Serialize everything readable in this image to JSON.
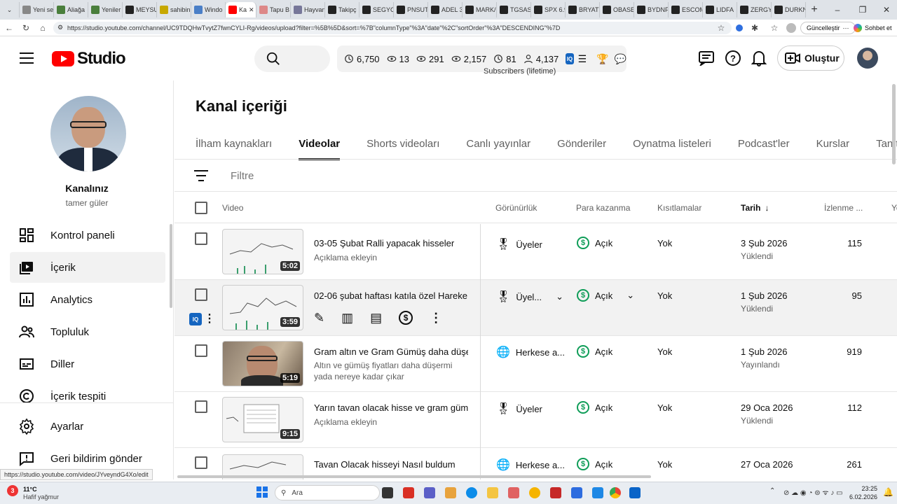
{
  "browser": {
    "tabs": [
      "Yeni se",
      "Aliağa",
      "Yeniler",
      "MEYSU",
      "sahibin",
      "Windo",
      "Ka",
      "Tapu B",
      "Hayvan",
      "Takipç",
      "SEGYO",
      "PNSUT",
      "ADEL 3",
      "MARK/",
      "TGSAS",
      "SPX 6.9",
      "BRYAT",
      "OBASE",
      "BYDNF",
      "ESCOM",
      "LIDFA",
      "ZERGY",
      "DURKN"
    ],
    "url": "https://studio.youtube.com/channel/UC9TDQHwTvytZ7fwnCYLI-Rg/videos/upload?filter=%5B%5D&sort=%7B\"columnType\"%3A\"date\"%2C\"sortOrder\"%3A\"DESCENDING\"%7D",
    "update_label": "Güncelleştir",
    "chat_label": "Sohbet et"
  },
  "header": {
    "logo_text": "Studio",
    "stats": [
      "6,750",
      "13",
      "291",
      "2,157",
      "81",
      "4,137"
    ],
    "tooltip": "Subscribers (lifetime)",
    "create_label": "Oluştur"
  },
  "sidebar": {
    "channel_title": "Kanalınız",
    "channel_name": "tamer güler",
    "items": [
      {
        "label": "Kontrol paneli",
        "icon": "dashboard-icon"
      },
      {
        "label": "İçerik",
        "icon": "content-icon"
      },
      {
        "label": "Analytics",
        "icon": "analytics-icon"
      },
      {
        "label": "Topluluk",
        "icon": "community-icon"
      },
      {
        "label": "Diller",
        "icon": "subtitles-icon"
      },
      {
        "label": "İçerik tespiti",
        "icon": "copyright-icon"
      },
      {
        "label": "Ayarlar",
        "icon": "settings-icon"
      },
      {
        "label": "Geri bildirim gönder",
        "icon": "feedback-icon"
      }
    ]
  },
  "main": {
    "title": "Kanal içeriği",
    "tabs": [
      "İlham kaynakları",
      "Videolar",
      "Shorts videoları",
      "Canlı yayınlar",
      "Gönderiler",
      "Oynatma listeleri",
      "Podcast'ler",
      "Kurslar",
      "Tanıtım"
    ],
    "filter_placeholder": "Filtre",
    "columns": {
      "video": "Video",
      "visibility": "Görünürlük",
      "monetization": "Para kazanma",
      "restrictions": "Kısıtlamalar",
      "date": "Tarih",
      "views": "İzlenme ...",
      "extra": "Yo"
    },
    "rows": [
      {
        "title": "03-05 Şubat Ralli yapacak hisseler",
        "desc": "Açıklama ekleyin",
        "duration": "5:02",
        "visibility": "Üyeler",
        "monetization": "Açık",
        "restrictions": "Yok",
        "date": "3 Şub 2026",
        "date_sub": "Yüklendi",
        "views": "115"
      },
      {
        "title": "02-06 şubat haftası katıla özel Hareke...",
        "desc": "",
        "duration": "3:59",
        "visibility": "Üyel...",
        "monetization": "Açık",
        "restrictions": "Yok",
        "date": "1 Şub 2026",
        "date_sub": "Yüklendi",
        "views": "95"
      },
      {
        "title": "Gram altın ve Gram Gümüş daha düşe...",
        "desc": "Altın ve gümüş fiyatları daha düşermi yada nereye kadar çıkar",
        "duration": "5:19",
        "visibility": "Herkese a...",
        "monetization": "Açık",
        "restrictions": "Yok",
        "date": "1 Şub 2026",
        "date_sub": "Yayınlandı",
        "views": "919"
      },
      {
        "title": "Yarın tavan olacak hisse ve gram güm...",
        "desc": "Açıklama ekleyin",
        "duration": "9:15",
        "visibility": "Üyeler",
        "monetization": "Açık",
        "restrictions": "Yok",
        "date": "29 Oca 2026",
        "date_sub": "Yüklendi",
        "views": "112"
      },
      {
        "title": "Tavan Olacak hisseyi Nasıl buldum",
        "desc": "",
        "duration": "",
        "visibility": "Herkese a...",
        "monetization": "Açık",
        "restrictions": "Yok",
        "date": "27 Oca 2026",
        "date_sub": "",
        "views": "261"
      }
    ]
  },
  "status_url": "https://studio.youtube.com/video/JYveyndG4Xo/edit",
  "taskbar": {
    "weather_temp": "11°C",
    "weather_desc": "Hafif yağmur",
    "weather_badge": "3",
    "search_label": "Ara",
    "time": "23:25",
    "date": "6.02.2026"
  },
  "colors": {
    "brand_red": "#ff0000",
    "money_green": "#0f9d58",
    "text": "#0f0f0f",
    "muted": "#606060"
  }
}
